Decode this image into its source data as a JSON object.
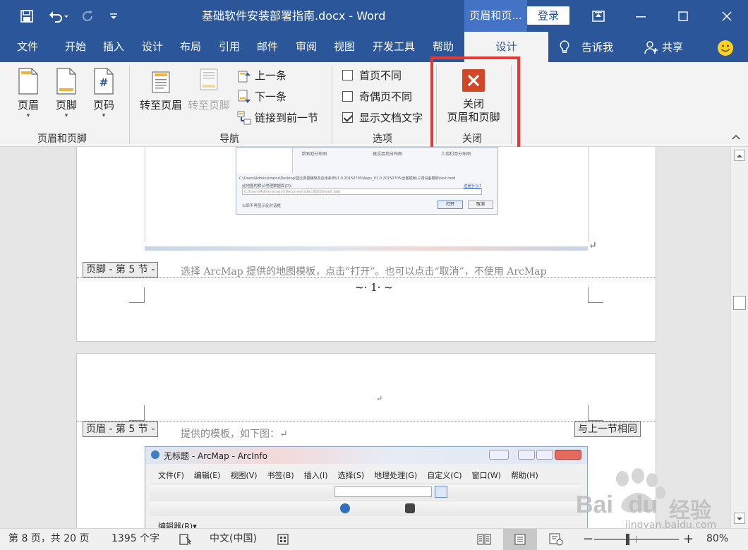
{
  "titlebar": {
    "document_title": "基础软件安装部署指南.docx  -  Word",
    "context_tab_title": "页眉和页...",
    "login_label": "登录",
    "icons": [
      "save-icon",
      "undo-icon",
      "redo-icon",
      "customize-quick-access-icon",
      "ribbon-display-options-icon",
      "minimize-icon",
      "maximize-icon",
      "close-icon"
    ]
  },
  "tabs": {
    "file": "文件",
    "home": "开始",
    "insert": "插入",
    "design": "设计",
    "layout": "布局",
    "references": "引用",
    "mailings": "邮件",
    "review": "审阅",
    "view": "视图",
    "developer": "开发工具",
    "help": "帮助",
    "hf_design": "设计",
    "tell_me": "告诉我",
    "share": "共享"
  },
  "ribbon": {
    "header_footer_group": {
      "header": "页眉",
      "footer": "页脚",
      "page_number": "页码",
      "label": "页眉和页脚"
    },
    "navigation_group": {
      "goto_header": "转至页眉",
      "goto_footer": "转至页脚",
      "previous": "上一条",
      "next": "下一条",
      "link_previous": "链接到前一节",
      "label": "导航"
    },
    "options_group": {
      "different_first": "首页不同",
      "different_first_checked": false,
      "different_odd_even": "奇偶页不同",
      "different_odd_even_checked": false,
      "show_doc_text": "显示文档文字",
      "show_doc_text_checked": true,
      "label": "选项"
    },
    "close_group": {
      "close_line1": "关闭",
      "close_line2": "页眉和页脚",
      "label": "关闭"
    },
    "colors": {
      "accent": "#2b579a",
      "close_icon": "#d24726",
      "highlight": "#e53935"
    }
  },
  "document": {
    "page1": {
      "footer_label": "页脚 - 第 5 节 -",
      "body_line": "选择 ArcMap 提供的地图模板，点击“打开”。也可以点击“取消”，不使用 ArcMap",
      "page_number": "~· 1· ~",
      "paragraph_mark": "↵"
    },
    "page2": {
      "header_label": "页眉 - 第 5 节 -",
      "body_line": "提供的模板，如下图：↵",
      "same_as_previous": "与上一节相同",
      "paragraph_mark": "↵"
    },
    "dialog_shot": {
      "col1": "单面地分布图",
      "col2": "建设用地分布图",
      "col3": "土地利用分布图",
      "path_line": "C:\\Users\\Administrator\\Desktop\\国土数据编辑及应用系统V1.0.20150705\\Apps_V1.0.20150705\\全图模板\\三调设备模板\\test.mxd",
      "default_db_label": "此地图的默认地理数据库(D):",
      "learn_more": "这是什么?",
      "db_path": "C:\\Users\\Administrator\\Documents\\ArcGIS\\Default.gdb",
      "dont_show": "以后不再显示此对话框",
      "open_button": "打开",
      "cancel_button": "取消"
    },
    "arcmap_shot": {
      "title": "无标题 - ArcMap - ArcInfo",
      "menus": [
        "文件(F)",
        "编辑(E)",
        "视图(V)",
        "书签(B)",
        "插入(I)",
        "选择(S)",
        "地理处理(G)",
        "自定义(C)",
        "窗口(W)",
        "帮助(H)"
      ],
      "editor_label": "编辑器(R)▾"
    }
  },
  "statusbar": {
    "page_info": "第 8 页，共 20 页",
    "word_count": "1395 个字",
    "language": "中文(中国)",
    "zoom": "80%",
    "zoom_minus": "−",
    "zoom_plus": "+"
  },
  "watermark": {
    "brand": "Bai",
    "brand2": "du",
    "text": "经验",
    "url": "jingyan.baidu.com"
  }
}
